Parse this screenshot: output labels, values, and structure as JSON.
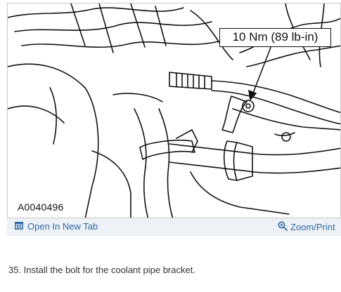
{
  "figure": {
    "torque_label": "10 Nm (89 lb-in)",
    "figure_id": "A0040496"
  },
  "actions": {
    "open_tab_label": "Open In New Tab",
    "open_tab_icon": "open-tab-icon",
    "zoom_label": "Zoom/Print",
    "zoom_icon": "zoom-icon"
  },
  "step": {
    "text": "35. Install the bolt for the coolant pipe bracket."
  }
}
